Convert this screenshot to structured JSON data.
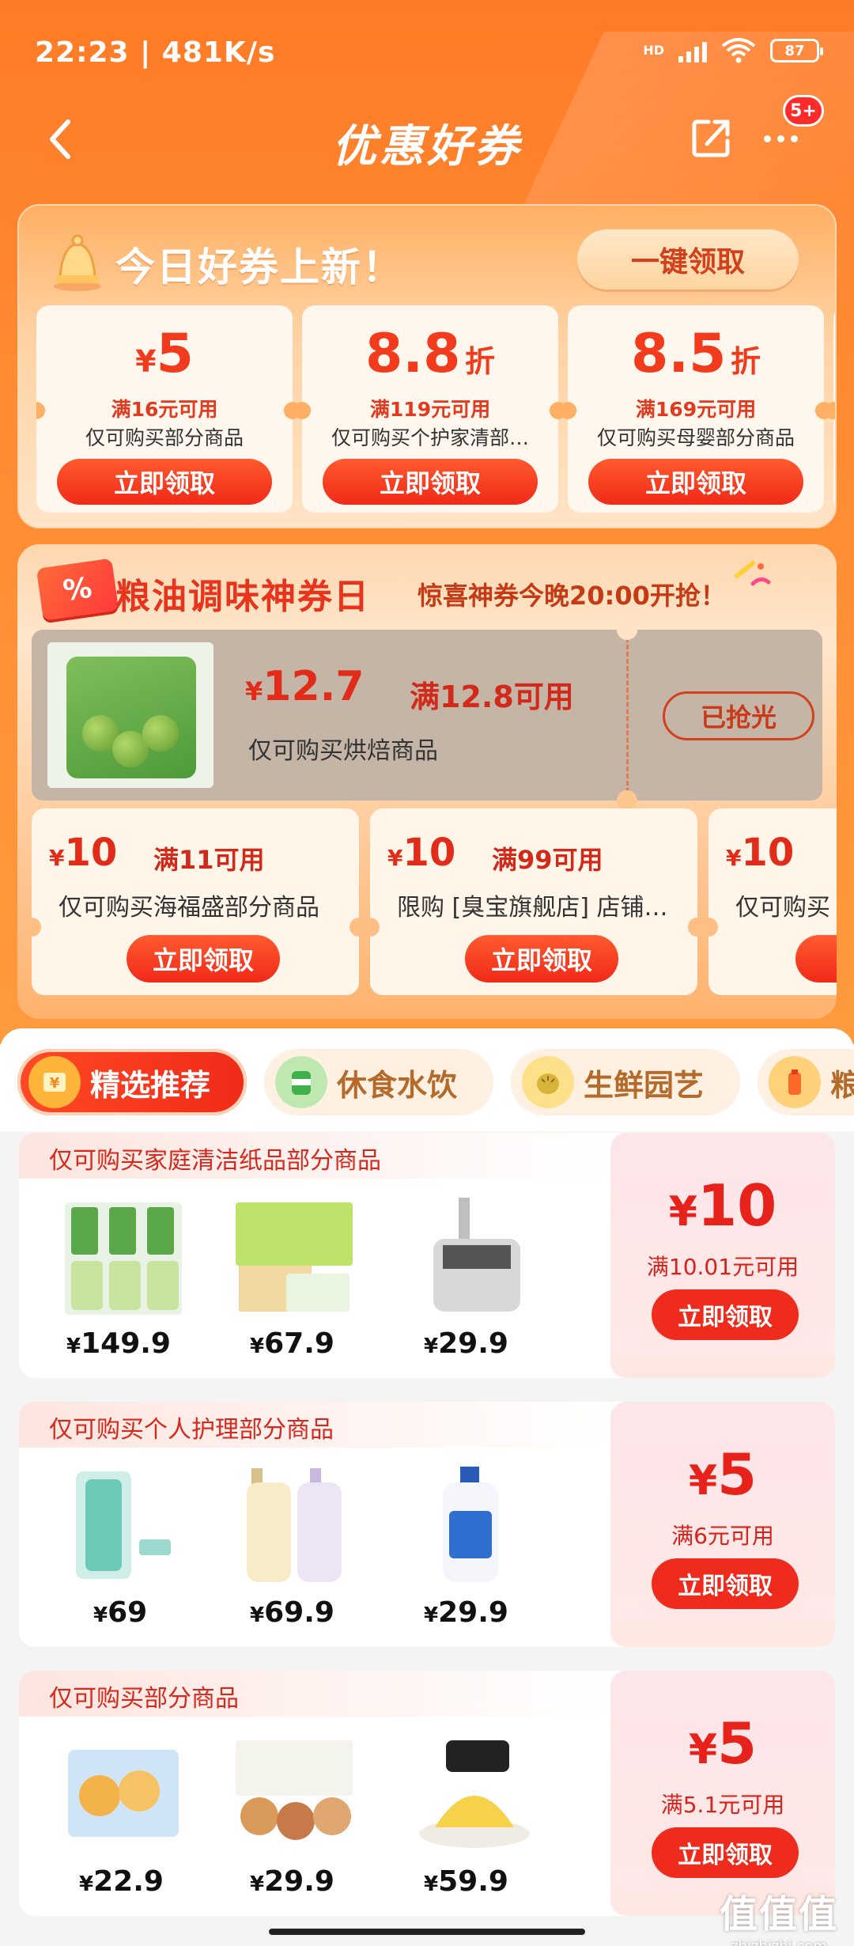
{
  "status": {
    "time": "22:23 | 481K/s",
    "network": "HD",
    "battery": "87"
  },
  "nav": {
    "title": "优惠好券",
    "badge": "5+"
  },
  "today": {
    "title": "今日好券上新！",
    "claim_all": "一键领取",
    "coupons": [
      {
        "yen": "¥",
        "amount": "5",
        "unit": "",
        "condition": "满16元可用",
        "scope": "仅可购买部分商品",
        "button": "立即领取"
      },
      {
        "yen": "",
        "amount": "8.8",
        "unit": "折",
        "condition": "满119元可用",
        "scope": "仅可购买个护家清部…",
        "button": "立即领取"
      },
      {
        "yen": "",
        "amount": "8.5",
        "unit": "折",
        "condition": "满169元可用",
        "scope": "仅可购买母婴部分商品",
        "button": "立即领取"
      }
    ]
  },
  "grain": {
    "icon_text": "%",
    "title": "粮油调味神券日",
    "subtitle": "惊喜神券今晚20:00开抢！",
    "featured": {
      "yen": "¥",
      "amount": "12.7",
      "condition": "满12.8可用",
      "scope": "仅可购买烘焙商品",
      "status": "已抢光"
    },
    "coupons": [
      {
        "yen": "¥",
        "amount": "10",
        "condition": "满11可用",
        "scope": "仅可购买海福盛部分商品",
        "button": "立即领取"
      },
      {
        "yen": "¥",
        "amount": "10",
        "condition": "满99可用",
        "scope": "限购 [臭宝旗舰店] 店铺…",
        "button": "立即领取"
      },
      {
        "yen": "¥",
        "amount": "10",
        "condition": "",
        "scope": "仅可购买",
        "button": "立"
      }
    ]
  },
  "tabs": [
    {
      "label": "精选推荐",
      "icon": "coupon-icon",
      "active": true
    },
    {
      "label": "休食水饮",
      "icon": "snack-icon",
      "active": false
    },
    {
      "label": "生鲜园艺",
      "icon": "durian-icon",
      "active": false
    },
    {
      "label": "粮",
      "icon": "oil-icon",
      "active": false
    }
  ],
  "cards": [
    {
      "header": "仅可购买家庭清洁纸品部分商品",
      "products": [
        {
          "price": "149.9",
          "icon": "detergent-icon"
        },
        {
          "price": "67.9",
          "icon": "tissue-icon"
        },
        {
          "price": "29.9",
          "icon": "dustpan-icon"
        }
      ],
      "coupon": {
        "yen": "¥",
        "amount": "10",
        "condition": "满10.01元可用",
        "button": "立即领取"
      }
    },
    {
      "header": "仅可购买个人护理部分商品",
      "products": [
        {
          "price": "69",
          "icon": "razor-icon"
        },
        {
          "price": "69.9",
          "icon": "shampoo-icon"
        },
        {
          "price": "29.9",
          "icon": "handwash-icon"
        }
      ],
      "coupon": {
        "yen": "¥",
        "amount": "5",
        "condition": "满6元可用",
        "button": "立即领取"
      }
    },
    {
      "header": "仅可购买部分商品",
      "products": [
        {
          "price": "22.9",
          "icon": "bread-icon"
        },
        {
          "price": "29.9",
          "icon": "bun-icon"
        },
        {
          "price": "59.9",
          "icon": "cake-icon"
        }
      ],
      "coupon": {
        "yen": "¥",
        "amount": "5",
        "condition": "满5.1元可用",
        "button": "立即领取"
      }
    }
  ],
  "watermark": {
    "big": "值值值",
    "small": "zhizhizhi.com"
  },
  "price_symbol": "¥"
}
